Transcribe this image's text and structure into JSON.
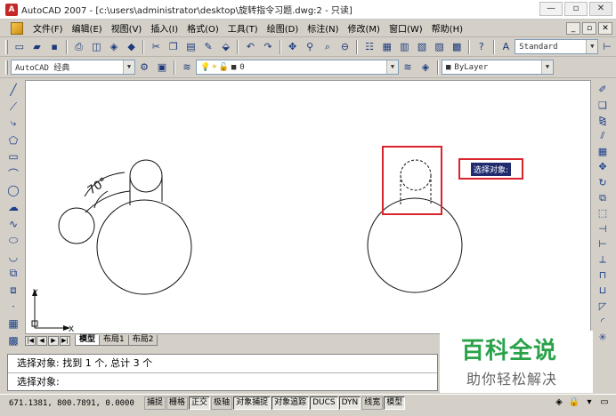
{
  "window": {
    "title": "AutoCAD 2007 - [c:\\users\\administrator\\desktop\\旋转指令习题.dwg:2 - 只读]",
    "app_badge": "A",
    "minimize": "—",
    "restore": "▫",
    "close": "✕"
  },
  "menu": [
    "文件(F)",
    "编辑(E)",
    "视图(V)",
    "插入(I)",
    "格式(O)",
    "工具(T)",
    "绘图(D)",
    "标注(N)",
    "修改(M)",
    "窗口(W)",
    "帮助(H)"
  ],
  "mdi": {
    "minimize": "_",
    "restore": "▫",
    "close": "✕"
  },
  "toolbar": {
    "text_style": "Standard",
    "workspace": "AutoCAD 经典",
    "layer": "0",
    "color": "ByLayer",
    "dropdown_arrow": "▼"
  },
  "canvas": {
    "dimension_text": "70°",
    "axis_y": "Y",
    "axis_x": "X",
    "tooltip": "选择对象:"
  },
  "tabs": {
    "nav": [
      "|◀",
      "◀",
      "▶",
      "▶|"
    ],
    "items": [
      "模型",
      "布局1",
      "布局2"
    ]
  },
  "command": {
    "history": "选择对象: 找到 1 个, 总计 3 个",
    "prompt": "选择对象:"
  },
  "watermark": {
    "title": "百科全说",
    "subtitle": "助你轻松解决"
  },
  "status": {
    "coords": "671.1381, 800.7891, 0.0000",
    "buttons": [
      {
        "label": "捕捉",
        "on": false
      },
      {
        "label": "栅格",
        "on": false
      },
      {
        "label": "正交",
        "on": true
      },
      {
        "label": "极轴",
        "on": false
      },
      {
        "label": "对象捕捉",
        "on": true
      },
      {
        "label": "对象追踪",
        "on": true
      },
      {
        "label": "DUCS",
        "on": true
      },
      {
        "label": "DYN",
        "on": true
      },
      {
        "label": "线宽",
        "on": false
      },
      {
        "label": "模型",
        "on": true
      }
    ]
  }
}
